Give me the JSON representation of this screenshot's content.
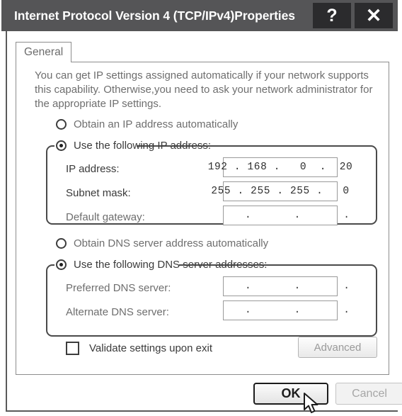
{
  "window": {
    "title": "Internet Protocol Version 4 (TCP/IPv4)Properties",
    "help_button": "?",
    "close_button": "✕"
  },
  "tabs": [
    {
      "label": "General",
      "selected": true
    }
  ],
  "main": {
    "description": "You can get IP settings assigned automatically if your network supports this capability. Otherwise,you need to ask your network administrator for the appropriate IP settings.",
    "ip_section": {
      "radio_automatic": {
        "label": "Obtain an IP address automatically",
        "selected": false
      },
      "radio_manual": {
        "label": "Use the following IP address:",
        "selected": true
      },
      "fields": [
        {
          "label": "IP address:",
          "value": "192 . 168 .   0  .  20"
        },
        {
          "label": "Subnet mask:",
          "value": "255 . 255 . 255 .   0"
        },
        {
          "label": "Default gateway:",
          "value": ".       .       ."
        }
      ]
    },
    "dns_section": {
      "radio_automatic": {
        "label": "Obtain DNS  server address automatically",
        "selected": false
      },
      "radio_manual": {
        "label": "Use the following DNS server addresses:",
        "selected": true
      },
      "fields": [
        {
          "label": "Preferred DNS server:",
          "value": ".       .       ."
        },
        {
          "label": "Alternate DNS server:",
          "value": ".       .       ."
        }
      ]
    },
    "validate": {
      "label": "Validate settings upon exit",
      "checked": false
    },
    "advanced_button": "Advanced"
  },
  "footer": {
    "ok_button": "OK",
    "cancel_button": "Cancel"
  },
  "colors": {
    "titlebar_bg": "#555557",
    "caption_btn_bg": "#2b2b2d",
    "dialog_border": "#5a5a5a",
    "group_border": "#4a4a4a",
    "text_muted": "#6e6e6e",
    "text_dark": "#3a3a3a"
  }
}
